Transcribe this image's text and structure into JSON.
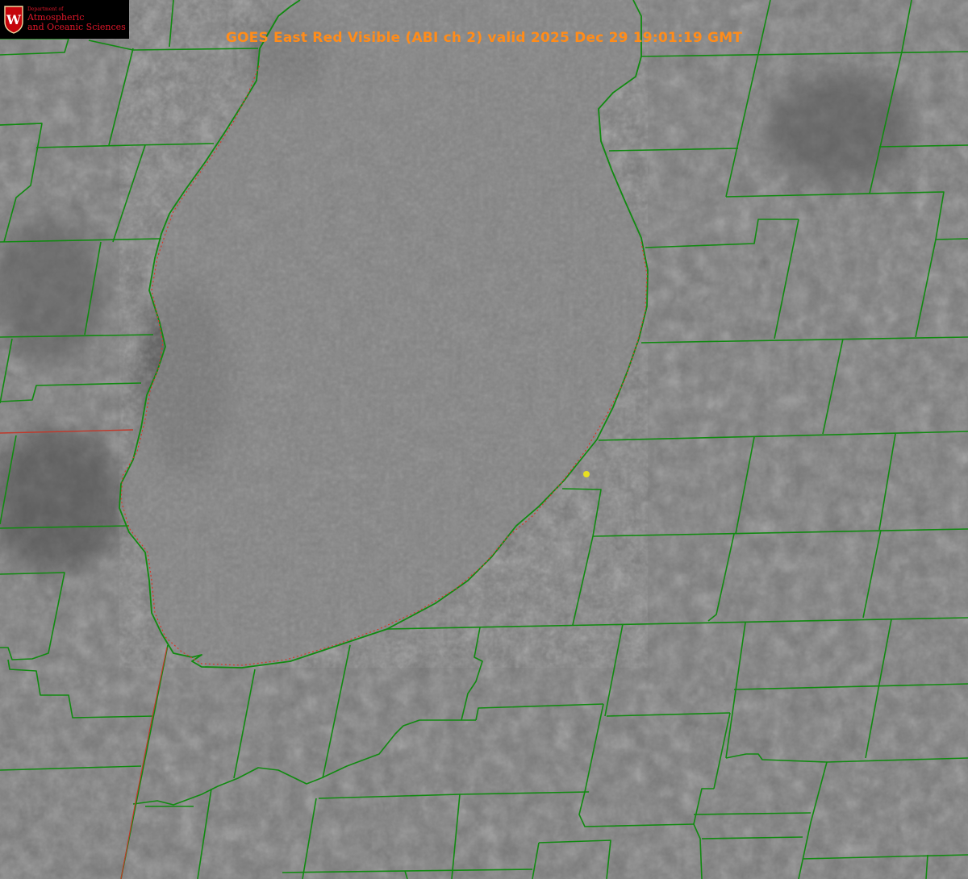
{
  "title": "GOES East Red Visible (ABI ch 2) valid 2025 Dec 29 19:01:19 GMT",
  "logo": {
    "department": "Department of",
    "line1": "Atmospheric",
    "line2": "and Oceanic Sciences",
    "crest_letter": "W"
  },
  "colors": {
    "county_lines": "#118a11",
    "state_line": "#c0392b",
    "title_text": "#ff8c1a",
    "logo_text": "#e0172a",
    "marker": "#e8e020"
  },
  "map": {
    "imagery": "grayscale visible satellite",
    "overlays": [
      "county-boundaries",
      "state-boundary",
      "lake-shoreline",
      "station-marker"
    ]
  }
}
